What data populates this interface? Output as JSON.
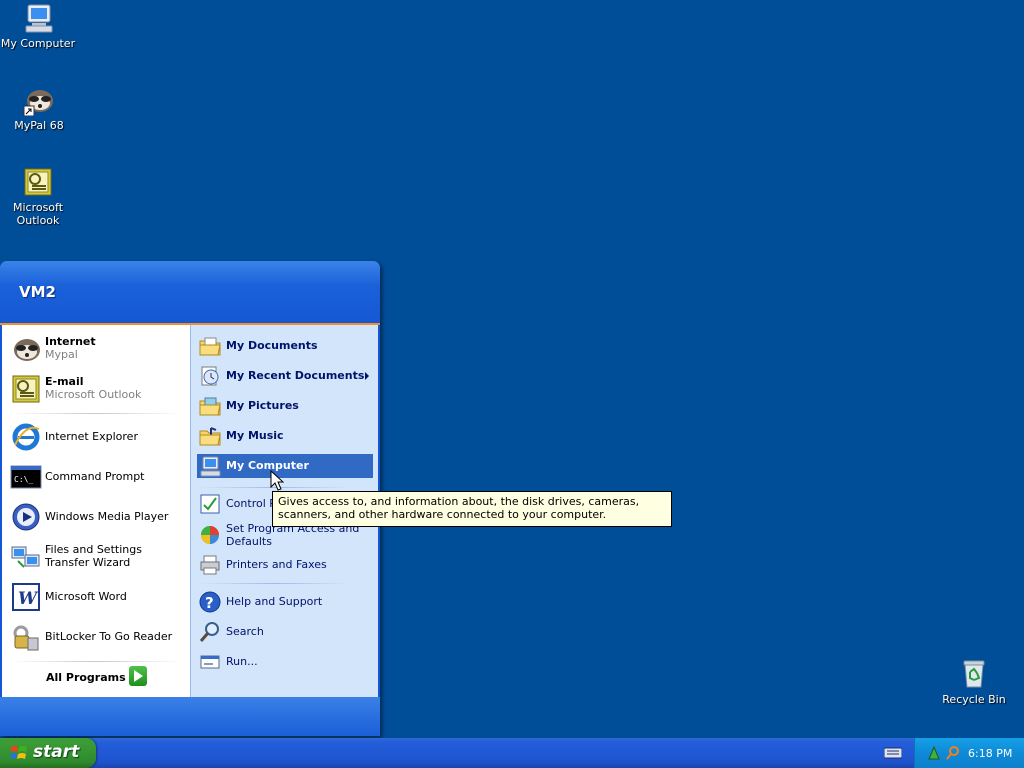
{
  "desktop": {
    "icons": [
      {
        "label": "My Computer",
        "icon": "my-computer-icon"
      },
      {
        "label": "MyPal 68",
        "icon": "mypal-icon"
      },
      {
        "label": "Microsoft Outlook",
        "icon": "outlook-icon"
      },
      {
        "label": "Recycle Bin",
        "icon": "recycle-bin-icon"
      }
    ],
    "background_color": "#004e98"
  },
  "start_menu": {
    "user_name": "VM2",
    "pinned": [
      {
        "title": "Internet",
        "subtitle": "Mypal",
        "icon": "mypal-icon"
      },
      {
        "title": "E-mail",
        "subtitle": "Microsoft Outlook",
        "icon": "outlook-icon"
      }
    ],
    "recent": [
      {
        "label": "Internet Explorer",
        "icon": "internet-explorer-icon"
      },
      {
        "label": "Command Prompt",
        "icon": "command-prompt-icon"
      },
      {
        "label": "Windows Media Player",
        "icon": "media-player-icon"
      },
      {
        "label": "Files and Settings Transfer Wizard",
        "icon": "transfer-wizard-icon"
      },
      {
        "label": "Microsoft Word",
        "icon": "word-icon"
      },
      {
        "label": "BitLocker To Go Reader",
        "icon": "bitlocker-icon"
      }
    ],
    "all_programs": "All Programs",
    "places": [
      {
        "label": "My Documents",
        "icon": "folder-documents-icon"
      },
      {
        "label": "My Recent Documents",
        "icon": "recent-documents-icon"
      },
      {
        "label": "My Pictures",
        "icon": "folder-pictures-icon"
      },
      {
        "label": "My Music",
        "icon": "folder-music-icon"
      },
      {
        "label": "My Computer",
        "icon": "my-computer-icon"
      }
    ],
    "settings": [
      {
        "label": "Control P",
        "icon": "control-panel-icon"
      },
      {
        "label": "Set Program Access and Defaults",
        "icon": "program-defaults-icon"
      },
      {
        "label": "Printers and Faxes",
        "icon": "printer-icon"
      }
    ],
    "support": [
      {
        "label": "Help and Support",
        "icon": "help-icon"
      },
      {
        "label": "Search",
        "icon": "search-icon"
      },
      {
        "label": "Run...",
        "icon": "run-icon"
      }
    ],
    "tooltip": "Gives access to, and information about, the disk drives, cameras, scanners, and other hardware connected to your computer."
  },
  "taskbar": {
    "start_label": "start",
    "clock": "6:18 PM"
  },
  "colors": {
    "start_green": "#3a9b35",
    "menu_blue": "#1456d6",
    "selected_blue": "#316ac5",
    "tray_blue": "#0f8ad6"
  }
}
